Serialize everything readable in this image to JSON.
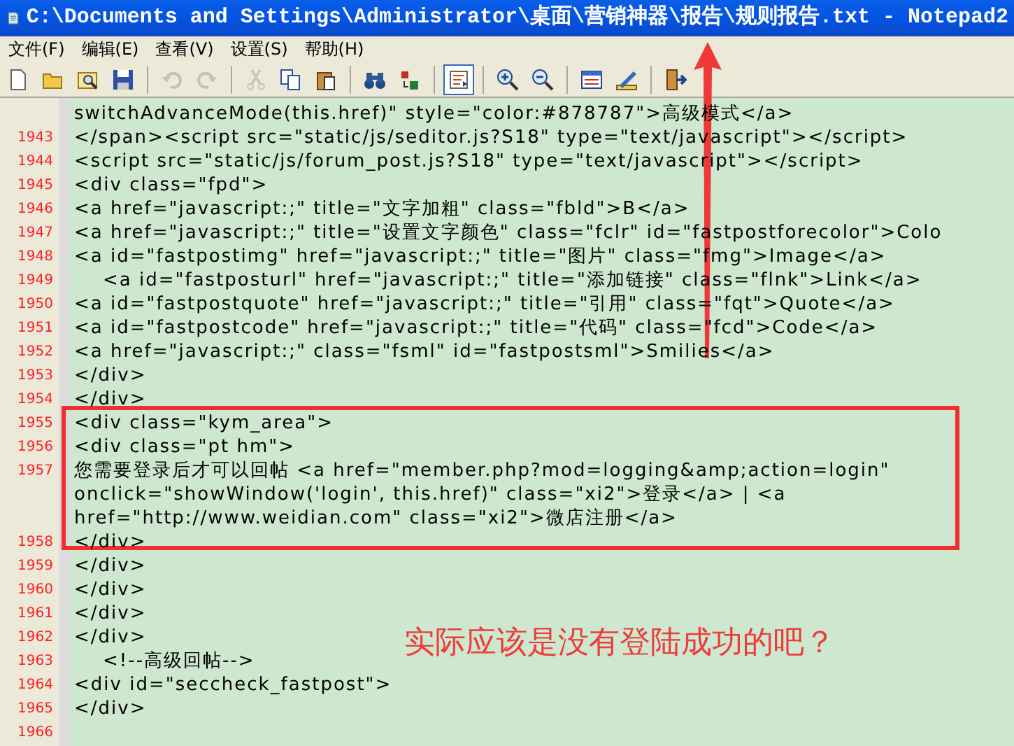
{
  "window": {
    "title": "C:\\Documents and Settings\\Administrator\\桌面\\营销神器\\报告\\规则报告.txt - Notepad2"
  },
  "menu": [
    "文件(F)",
    "编辑(E)",
    "查看(V)",
    "设置(S)",
    "帮助(H)"
  ],
  "toolbar": [
    {
      "kind": "new",
      "disabled": false,
      "pressed": false
    },
    {
      "kind": "open",
      "disabled": false,
      "pressed": false
    },
    {
      "kind": "browse",
      "disabled": false,
      "pressed": false
    },
    {
      "kind": "save",
      "disabled": false,
      "pressed": false
    },
    {
      "kind": "separator"
    },
    {
      "kind": "undo",
      "disabled": true,
      "pressed": false
    },
    {
      "kind": "redo",
      "disabled": true,
      "pressed": false
    },
    {
      "kind": "separator"
    },
    {
      "kind": "cut",
      "disabled": true,
      "pressed": false
    },
    {
      "kind": "copy",
      "disabled": false,
      "pressed": false
    },
    {
      "kind": "paste",
      "disabled": false,
      "pressed": false
    },
    {
      "kind": "separator"
    },
    {
      "kind": "find",
      "disabled": false,
      "pressed": false
    },
    {
      "kind": "replace",
      "disabled": false,
      "pressed": false
    },
    {
      "kind": "separator"
    },
    {
      "kind": "wrap",
      "disabled": false,
      "pressed": true
    },
    {
      "kind": "separator"
    },
    {
      "kind": "zoomin",
      "disabled": false,
      "pressed": false
    },
    {
      "kind": "zoomout",
      "disabled": false,
      "pressed": false
    },
    {
      "kind": "separator"
    },
    {
      "kind": "scheme",
      "disabled": false,
      "pressed": false
    },
    {
      "kind": "customize",
      "disabled": false,
      "pressed": false
    },
    {
      "kind": "separator"
    },
    {
      "kind": "exit",
      "disabled": false,
      "pressed": false
    }
  ],
  "editor": {
    "lines": [
      {
        "text": "switchAdvanceMode(this.href)\" style=\"color:#878787\">高级模式</a>"
      },
      {
        "number": "1943",
        "text": "</span><script src=\"static/js/seditor.js?S18\" type=\"text/javascript\"></script>"
      },
      {
        "number": "1944",
        "text": "<script src=\"static/js/forum_post.js?S18\" type=\"text/javascript\"></script>"
      },
      {
        "number": "1945",
        "text": "<div class=\"fpd\">"
      },
      {
        "number": "1946",
        "text": "<a href=\"javascript:;\" title=\"文字加粗\" class=\"fbld\">B</a>"
      },
      {
        "number": "1947",
        "text": "<a href=\"javascript:;\" title=\"设置文字颜色\" class=\"fclr\" id=\"fastpostforecolor\">Colo"
      },
      {
        "number": "1948",
        "text": "<a id=\"fastpostimg\" href=\"javascript:;\" title=\"图片\" class=\"fmg\">Image</a>"
      },
      {
        "number": "1949",
        "text": "    <a id=\"fastposturl\" href=\"javascript:;\" title=\"添加链接\" class=\"flnk\">Link</a>"
      },
      {
        "number": "1950",
        "text": "<a id=\"fastpostquote\" href=\"javascript:;\" title=\"引用\" class=\"fqt\">Quote</a>"
      },
      {
        "number": "1951",
        "text": "<a id=\"fastpostcode\" href=\"javascript:;\" title=\"代码\" class=\"fcd\">Code</a>"
      },
      {
        "number": "1952",
        "text": "<a href=\"javascript:;\" class=\"fsml\" id=\"fastpostsml\">Smilies</a>"
      },
      {
        "number": "1953",
        "text": "</div>"
      },
      {
        "number": "1954",
        "text": "</div>"
      },
      {
        "number": "1955",
        "text": "<div class=\"kym_area\">"
      },
      {
        "number": "1956",
        "text": "<div class=\"pt hm\">"
      },
      {
        "number": "1957",
        "text": "您需要登录后才可以回帖 <a href=\"member.php?mod=logging&amp;action=login\""
      },
      {
        "text": "onclick=\"showWindow('login', this.href)\" class=\"xi2\">登录</a> | <a"
      },
      {
        "text": "href=\"http://www.weidian.com\" class=\"xi2\">微店注册</a>"
      },
      {
        "number": "1958",
        "text": "</div>"
      },
      {
        "number": "1959",
        "text": "</div>"
      },
      {
        "number": "1960",
        "text": "</div>"
      },
      {
        "number": "1961",
        "text": "</div>"
      },
      {
        "number": "1962",
        "text": "</div>"
      },
      {
        "number": "1963",
        "text": "    <!--高级回帖-->"
      },
      {
        "number": "1964",
        "text": "<div id=\"seccheck_fastpost\">"
      },
      {
        "number": "1965",
        "text": "</div>"
      },
      {
        "number": "1966"
      }
    ]
  },
  "annotation": {
    "text": "实际应该是没有登陆成功的吧？"
  }
}
